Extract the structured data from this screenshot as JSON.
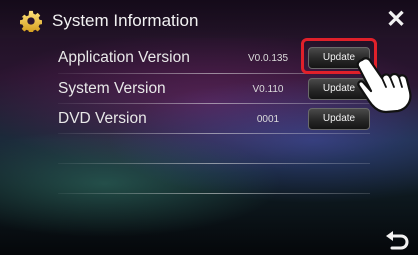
{
  "header": {
    "title": "System Information",
    "icon": "gear-icon",
    "close_label": "✕"
  },
  "rows": [
    {
      "label": "Application Version",
      "version": "V0.0.135",
      "button": "Update"
    },
    {
      "label": "System Version",
      "version": "V0.110",
      "button": "Update"
    },
    {
      "label": "DVD Version",
      "version": "0001",
      "button": "Update"
    }
  ],
  "highlight": {
    "color": "#e0202a"
  },
  "footer": {
    "back_icon": "back-arrow-icon"
  }
}
